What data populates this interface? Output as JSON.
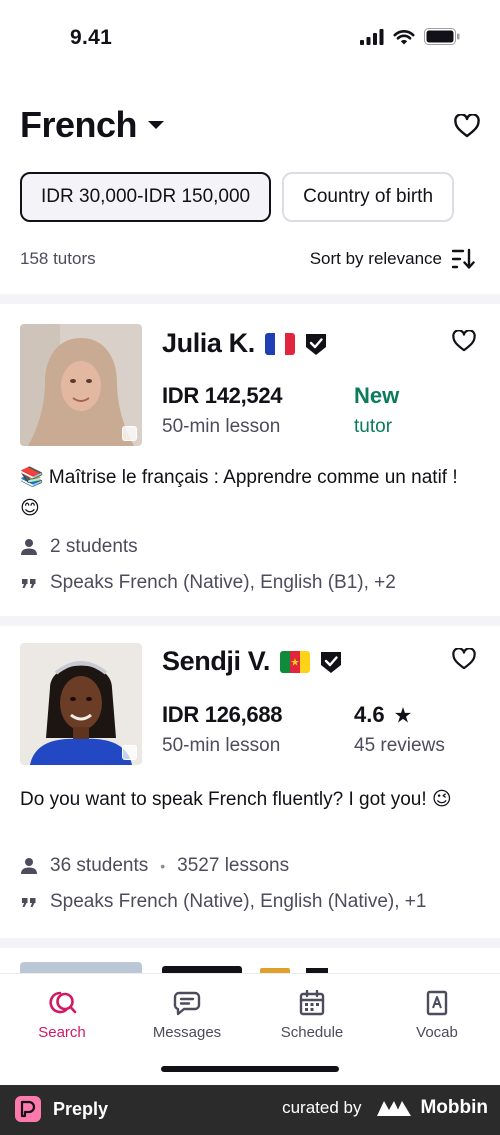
{
  "status_bar": {
    "time": "9.41"
  },
  "header": {
    "language": "French"
  },
  "filters": [
    {
      "label": "IDR 30,000-IDR 150,000",
      "active": true
    },
    {
      "label": "Country of birth",
      "active": false
    }
  ],
  "results": {
    "count": "158 tutors",
    "sort_label": "Sort by relevance"
  },
  "tutors": [
    {
      "name": "Julia K.",
      "flag": "france",
      "price": "IDR 142,524",
      "lesson": "50-min lesson",
      "rating_or_status": "New",
      "rating_sub": "tutor",
      "headline": "📚 Maîtrise le français : Apprendre comme un natif ! 😊",
      "students": "2 students",
      "lessons": "",
      "speaks": "Speaks French (Native), English (B1), +2"
    },
    {
      "name": "Sendji V.",
      "flag": "cameroon",
      "price": "IDR 126,688",
      "lesson": "50-min lesson",
      "rating_or_status": "4.6",
      "rating_sub": "45 reviews",
      "headline": "Do you want to speak French fluently? I got you! 😉",
      "students": "36 students",
      "lessons": "3527 lessons",
      "speaks": "Speaks French (Native), English (Native), +1"
    }
  ],
  "tab_bar": [
    {
      "label": "Search",
      "icon": "search-icon",
      "active": true
    },
    {
      "label": "Messages",
      "icon": "message-icon",
      "active": false
    },
    {
      "label": "Schedule",
      "icon": "calendar-icon",
      "active": false
    },
    {
      "label": "Vocab",
      "icon": "vocab-icon",
      "active": false
    }
  ],
  "footer": {
    "brand": "Preply",
    "curated_by": "curated by",
    "curator": "Mobbin"
  },
  "colors": {
    "accent": "#d11963",
    "new_tutor": "#0a7c59",
    "text": "#121117",
    "muted": "#4d4c5c"
  }
}
